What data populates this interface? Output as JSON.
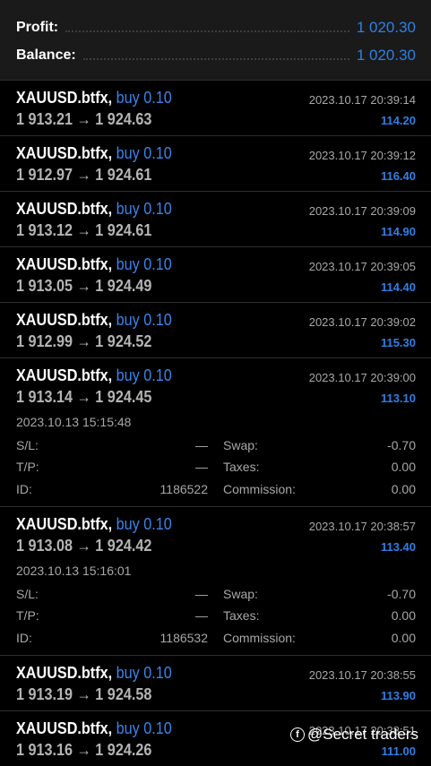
{
  "summary": {
    "profit_label": "Profit:",
    "profit_value": "1 020.30",
    "balance_label": "Balance:",
    "balance_value": "1 020.30"
  },
  "trades": [
    {
      "symbol": "XAUUSD.btfx,",
      "direction": "buy 0.10",
      "open_price": "1 913.21",
      "close_price": "1 924.63",
      "close_time": "2023.10.17 20:39:14",
      "profit": "114.20"
    },
    {
      "symbol": "XAUUSD.btfx,",
      "direction": "buy 0.10",
      "open_price": "1 912.97",
      "close_price": "1 924.61",
      "close_time": "2023.10.17 20:39:12",
      "profit": "116.40"
    },
    {
      "symbol": "XAUUSD.btfx,",
      "direction": "buy 0.10",
      "open_price": "1 913.12",
      "close_price": "1 924.61",
      "close_time": "2023.10.17 20:39:09",
      "profit": "114.90"
    },
    {
      "symbol": "XAUUSD.btfx,",
      "direction": "buy 0.10",
      "open_price": "1 913.05",
      "close_price": "1 924.49",
      "close_time": "2023.10.17 20:39:05",
      "profit": "114.40"
    },
    {
      "symbol": "XAUUSD.btfx,",
      "direction": "buy 0.10",
      "open_price": "1 912.99",
      "close_price": "1 924.52",
      "close_time": "2023.10.17 20:39:02",
      "profit": "115.30"
    },
    {
      "symbol": "XAUUSD.btfx,",
      "direction": "buy 0.10",
      "open_price": "1 913.14",
      "close_price": "1 924.45",
      "close_time": "2023.10.17 20:39:00",
      "profit": "113.10",
      "details": {
        "open_time": "2023.10.13 15:15:48",
        "sl_label": "S/L:",
        "sl": "—",
        "tp_label": "T/P:",
        "tp": "—",
        "id_label": "ID:",
        "id": "1186522",
        "swap_label": "Swap:",
        "swap": "-0.70",
        "taxes_label": "Taxes:",
        "taxes": "0.00",
        "commission_label": "Commission:",
        "commission": "0.00"
      }
    },
    {
      "symbol": "XAUUSD.btfx,",
      "direction": "buy 0.10",
      "open_price": "1 913.08",
      "close_price": "1 924.42",
      "close_time": "2023.10.17 20:38:57",
      "profit": "113.40",
      "details": {
        "open_time": "2023.10.13 15:16:01",
        "sl_label": "S/L:",
        "sl": "—",
        "tp_label": "T/P:",
        "tp": "—",
        "id_label": "ID:",
        "id": "1186532",
        "swap_label": "Swap:",
        "swap": "-0.70",
        "taxes_label": "Taxes:",
        "taxes": "0.00",
        "commission_label": "Commission:",
        "commission": "0.00"
      }
    },
    {
      "symbol": "XAUUSD.btfx,",
      "direction": "buy 0.10",
      "open_price": "1 913.19",
      "close_price": "1 924.58",
      "close_time": "2023.10.17 20:38:55",
      "profit": "113.90"
    },
    {
      "symbol": "XAUUSD.btfx,",
      "direction": "buy 0.10",
      "open_price": "1 913.16",
      "close_price": "1 924.26",
      "close_time": "2023.10.17 20:38:51",
      "profit": "111.00"
    }
  ],
  "arrow": "→",
  "watermark": {
    "icon": "facebook-icon",
    "text": "@Secret traders"
  },
  "colors": {
    "accent": "#2f7fe6",
    "background": "#000000",
    "summary_bg": "#1a1a1a"
  }
}
